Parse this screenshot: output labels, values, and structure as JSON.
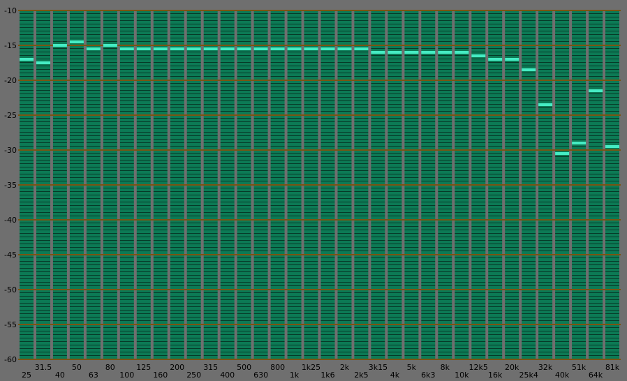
{
  "chart_data": {
    "type": "bar",
    "title": "",
    "xlabel": "",
    "ylabel": "",
    "ylim": [
      -60,
      -10
    ],
    "y_ticks": [
      "-10",
      "-15",
      "-20",
      "-25",
      "-30",
      "-35",
      "-40",
      "-45",
      "-50",
      "-55",
      "-60"
    ],
    "y_tick_values": [
      -10,
      -15,
      -20,
      -25,
      -30,
      -35,
      -40,
      -45,
      -50,
      -55,
      -60
    ],
    "grid": true,
    "categories": [
      "25",
      "31.5",
      "40",
      "50",
      "63",
      "80",
      "100",
      "125",
      "160",
      "200",
      "250",
      "315",
      "400",
      "500",
      "630",
      "800",
      "1k",
      "1k25",
      "1k6",
      "2k",
      "2k5",
      "3k15",
      "4k",
      "5k",
      "6k3",
      "8k",
      "10k",
      "12k5",
      "16k",
      "20k",
      "25k4",
      "32k",
      "40k",
      "51k",
      "64k",
      "81k"
    ],
    "series": [
      {
        "values": [
          -17,
          -17.5,
          -15,
          -14.5,
          -15.5,
          -15,
          -15.5,
          -15.5,
          -15.5,
          -15.5,
          -15.5,
          -15.5,
          -15.5,
          -15.5,
          -15.5,
          -15.5,
          -15.5,
          -15.5,
          -15.5,
          -15.5,
          -15.5,
          -16,
          -16,
          -16,
          -16,
          -16,
          -16,
          -16.5,
          -17,
          -17,
          -18.5,
          -23.5,
          -30.5,
          -29,
          -21.5,
          -29.5
        ]
      }
    ]
  },
  "colors": {
    "background": "#6f6f6f",
    "bar_fill": "#0c7a55",
    "bar_segment_line": "#063a28",
    "peak_marker": "#46ecc4",
    "major_gridline": "#7a5412",
    "divider": "#555555"
  }
}
